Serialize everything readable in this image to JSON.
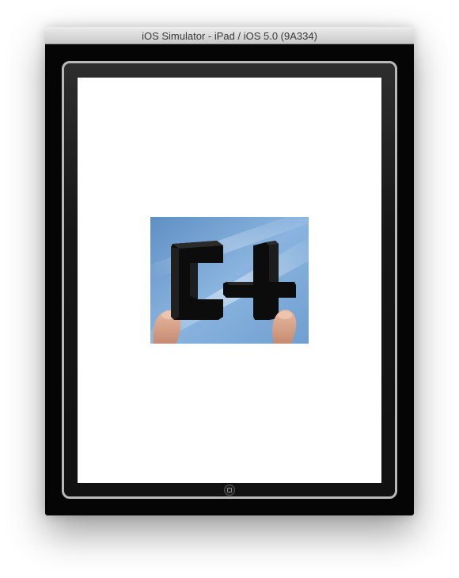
{
  "window": {
    "title": "iOS Simulator - iPad / iOS 5.0 (9A334)"
  },
  "device": {
    "type": "iPad",
    "body_color": "#050505",
    "bezel_color": "#b9b9b9",
    "screen_color": "#ffffff"
  },
  "screen": {
    "image": {
      "description_icon": "c4-logo-photo",
      "sky_color": "#6f9fd0",
      "logo_color": "#0c0c0c",
      "finger_color": "#d9a48a"
    }
  },
  "controls": {
    "home_button_icon": "home-button-icon"
  }
}
